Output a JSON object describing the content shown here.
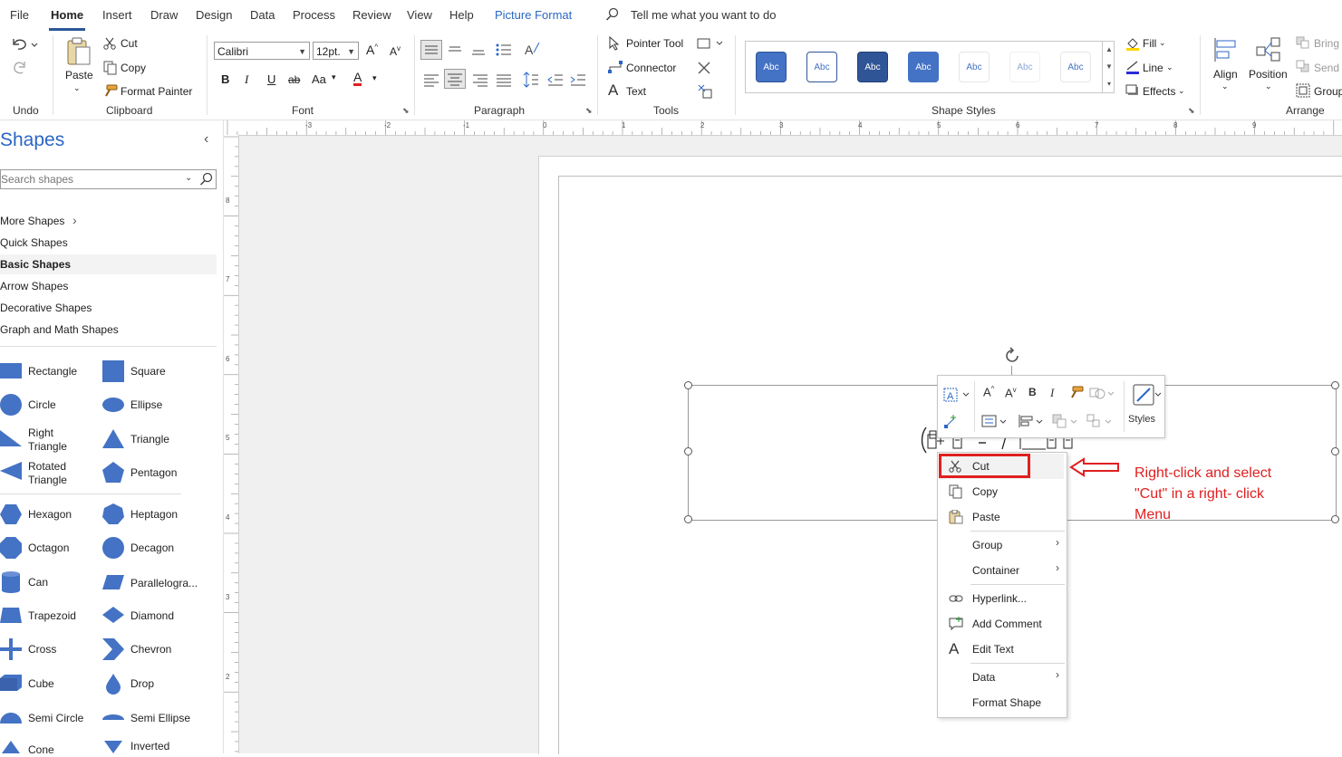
{
  "menubar": {
    "tabs": [
      "File",
      "Home",
      "Insert",
      "Draw",
      "Design",
      "Data",
      "Process",
      "Review",
      "View",
      "Help",
      "Picture Format"
    ],
    "active_tab": "Home",
    "tell_me": "Tell me what you want to do"
  },
  "ribbon": {
    "undo_group": "Undo",
    "clipboard": {
      "group": "Clipboard",
      "paste": "Paste",
      "cut": "Cut",
      "copy": "Copy",
      "format_painter": "Format Painter"
    },
    "font": {
      "group": "Font",
      "family": "Calibri",
      "size": "12pt.",
      "case": "Aa"
    },
    "paragraph": {
      "group": "Paragraph"
    },
    "tools": {
      "group": "Tools",
      "pointer": "Pointer Tool",
      "connector": "Connector",
      "text": "Text"
    },
    "shape_styles": {
      "group": "Shape Styles",
      "swatches": [
        "Abc",
        "Abc",
        "Abc",
        "Abc",
        "Abc",
        "Abc",
        "Abc"
      ],
      "fill": "Fill",
      "line": "Line",
      "effects": "Effects"
    },
    "arrange": {
      "group": "Arrange",
      "align": "Align",
      "position": "Position",
      "bring": "Bring",
      "send": "Send",
      "group_btn": "Group"
    }
  },
  "panel": {
    "title": "Shapes",
    "search_placeholder": "Search shapes",
    "nav": [
      "More Shapes",
      "Quick Shapes",
      "Basic Shapes",
      "Arrow Shapes",
      "Decorative Shapes",
      "Graph and Math Shapes"
    ],
    "selected_nav": "Basic Shapes",
    "shapes_left": [
      "Rectangle",
      "Circle",
      "Right Triangle",
      "Rotated Triangle",
      "Hexagon",
      "Octagon",
      "Can",
      "Trapezoid",
      "Cross",
      "Cube",
      "Semi Circle",
      "Cone"
    ],
    "shapes_right": [
      "Square",
      "Ellipse",
      "Triangle",
      "Pentagon",
      "Heptagon",
      "Decagon",
      "Parallelogra...",
      "Diamond",
      "Chevron",
      "Drop",
      "Semi Ellipse",
      "Inverted"
    ]
  },
  "ruler": {
    "h_numbers": [
      "-3",
      "-2",
      "-1",
      "0",
      "1",
      "2",
      "3",
      "4",
      "5",
      "6",
      "7",
      "8",
      "9"
    ],
    "v_numbers": [
      "8",
      "7",
      "6",
      "5",
      "4",
      "3",
      "2"
    ]
  },
  "mini_toolbar": {
    "styles": "Styles"
  },
  "context_menu": {
    "items": [
      "Cut",
      "Copy",
      "Paste",
      "Group",
      "Container",
      "Hyperlink...",
      "Add Comment",
      "Edit Text",
      "Data",
      "Format Shape"
    ]
  },
  "annotation": {
    "text_line1": "Right-click and select",
    "text_line2": "\"Cut\" in a right- click",
    "text_line3": "Menu",
    "color": "#e02020"
  },
  "colors": {
    "accent": "#2b579a",
    "shape_blue": "#4472c4",
    "context_tab": "#2b66c5"
  }
}
